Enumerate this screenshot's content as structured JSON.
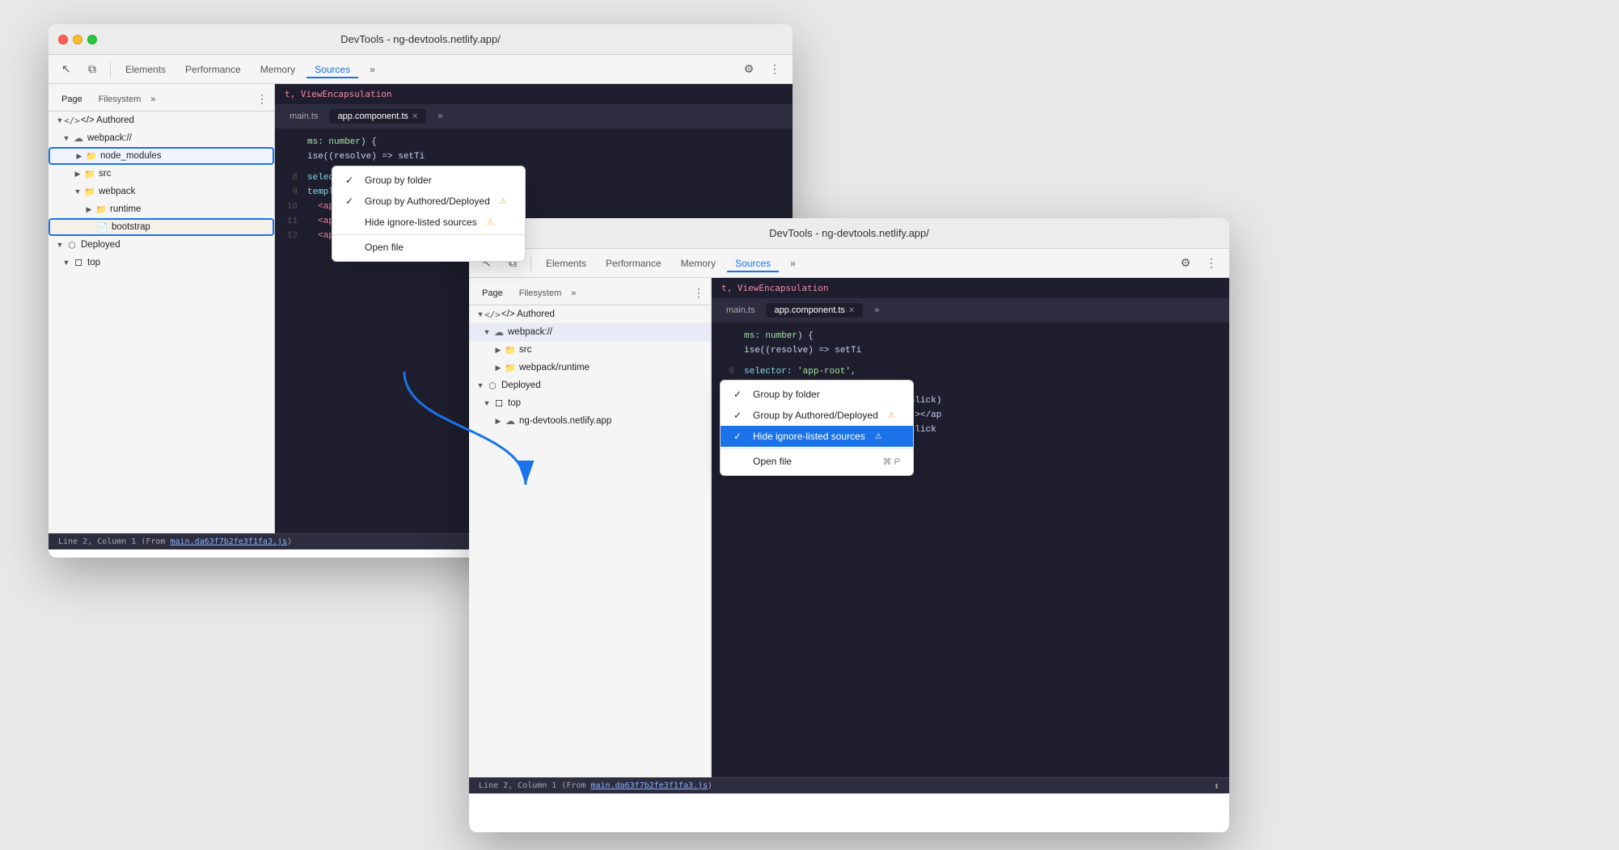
{
  "window_back": {
    "title": "DevTools - ng-devtools.netlify.app/",
    "toolbar_tabs": [
      "Elements",
      "Performance",
      "Memory",
      "Sources"
    ],
    "active_toolbar_tab": "Sources",
    "panel_tabs": [
      "Page",
      "Filesystem"
    ],
    "code_tabs": [
      "main.ts",
      "app.component.ts"
    ],
    "active_code_tab": "app.component.ts",
    "file_tree": {
      "authored_label": "</> Authored",
      "webpack_label": "webpack://",
      "node_modules_label": "node_modules",
      "src_label": "src",
      "webpack_folder_label": "webpack",
      "runtime_label": "runtime",
      "bootstrap_label": "bootstrap",
      "deployed_label": "Deployed",
      "top_label": "top"
    },
    "context_menu": {
      "items": [
        {
          "label": "Group by folder",
          "checked": true,
          "shortcut": ""
        },
        {
          "label": "Group by Authored/Deployed",
          "checked": true,
          "warn": true,
          "shortcut": ""
        },
        {
          "label": "Hide ignore-listed sources",
          "checked": false,
          "warn": true,
          "shortcut": ""
        },
        {
          "label": "Open file",
          "checked": false,
          "shortcut": ""
        }
      ]
    },
    "code_lines": [
      {
        "num": "",
        "code": "selector: 'app-root',"
      },
      {
        "num": "8",
        "code": "template: `<section>"
      },
      {
        "num": "9",
        "code": "  <app-button label=\"-\" (handleClick"
      },
      {
        "num": "10",
        "code": "  <app-label [counter]=\"counter\"></ap"
      },
      {
        "num": "11",
        "code": "  <app-"
      }
    ],
    "code_lines_top": [
      {
        "code": "t, ViewEncapsulation"
      }
    ],
    "code_lines_mid": [
      {
        "code": "ms: number) {"
      },
      {
        "code": "ise((resolve) => setTi"
      }
    ],
    "status_bar": "Line 2, Column 1 (From main.da63f7b2fe3f1fa3.js)"
  },
  "window_front": {
    "title": "DevTools - ng-devtools.netlify.app/",
    "toolbar_tabs": [
      "Elements",
      "Performance",
      "Memory",
      "Sources"
    ],
    "active_toolbar_tab": "Sources",
    "panel_tabs": [
      "Page",
      "Filesystem"
    ],
    "code_tabs": [
      "main.ts",
      "app.component.ts"
    ],
    "active_code_tab": "app.component.ts",
    "file_tree": {
      "authored_label": "</> Authored",
      "webpack_label": "webpack://",
      "src_label": "src",
      "webpack_runtime_label": "webpack/runtime",
      "deployed_label": "Deployed",
      "top_label": "top",
      "ng_devtools_label": "ng-devtools.netlify.app"
    },
    "context_menu": {
      "items": [
        {
          "label": "Group by folder",
          "checked": true,
          "shortcut": ""
        },
        {
          "label": "Group by Authored/Deployed",
          "checked": true,
          "warn": true,
          "shortcut": ""
        },
        {
          "label": "Hide ignore-listed sources",
          "checked": true,
          "warn": true,
          "active": true,
          "shortcut": ""
        },
        {
          "label": "Open file",
          "checked": false,
          "shortcut": "⌘ P"
        }
      ]
    },
    "code_lines_top": [
      {
        "code": "t, ViewEncapsulation"
      }
    ],
    "code_lines_mid": [
      {
        "code": "ms: number) {"
      },
      {
        "code": "ise((resolve) => setTi"
      }
    ],
    "code_lines_bottom": [
      {
        "num": "8",
        "code": "selector: 'app-root',"
      },
      {
        "num": "9",
        "code": "template: `<section>"
      },
      {
        "num": "10",
        "code": "  <app-button label=\"-\" (handleClick)"
      },
      {
        "num": "11",
        "code": "  <app-label [counter]=\"counter\"></ap"
      },
      {
        "num": "12",
        "code": "  <app-button label=\"+\" (handleClick"
      }
    ],
    "status_bar": "Line 2, Column 1 (From main.da63f7b2fe3f1fa3.js)"
  },
  "icons": {
    "arrow_back": "◀",
    "copy": "⧉",
    "more": "»",
    "three_dots": "⋮",
    "gear": "⚙",
    "cursor": "↖",
    "more_horiz": "»"
  }
}
